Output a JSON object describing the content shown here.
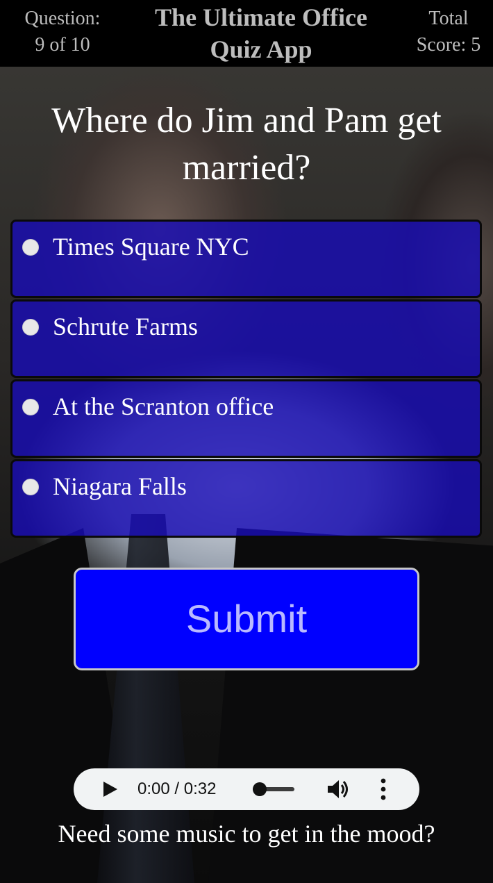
{
  "header": {
    "question_label": "Question:",
    "question_count": "9 of 10",
    "title_line1": "The Ultimate Office",
    "title_line2": "Quiz App",
    "score_label": "Total",
    "score_value": "Score: 5"
  },
  "question": {
    "text": "Where do Jim and Pam get married?"
  },
  "answers": [
    {
      "label": "Times Square NYC"
    },
    {
      "label": "Schrute Farms"
    },
    {
      "label": "At the Scranton office"
    },
    {
      "label": "Niagara Falls"
    }
  ],
  "submit": {
    "label": "Submit"
  },
  "player": {
    "time": "0:00 / 0:32",
    "progress_fraction": 0.0,
    "icons": [
      "play-icon",
      "volume-icon",
      "more-vert-icon"
    ]
  },
  "caption": {
    "text": "Need some music to get in the mood?"
  },
  "colors": {
    "header_bg": "#000000",
    "header_text": "#bdbdbd",
    "answer_bg": "#180cb4",
    "submit_bg": "#0000ff",
    "submit_text": "#b9b9ff"
  }
}
